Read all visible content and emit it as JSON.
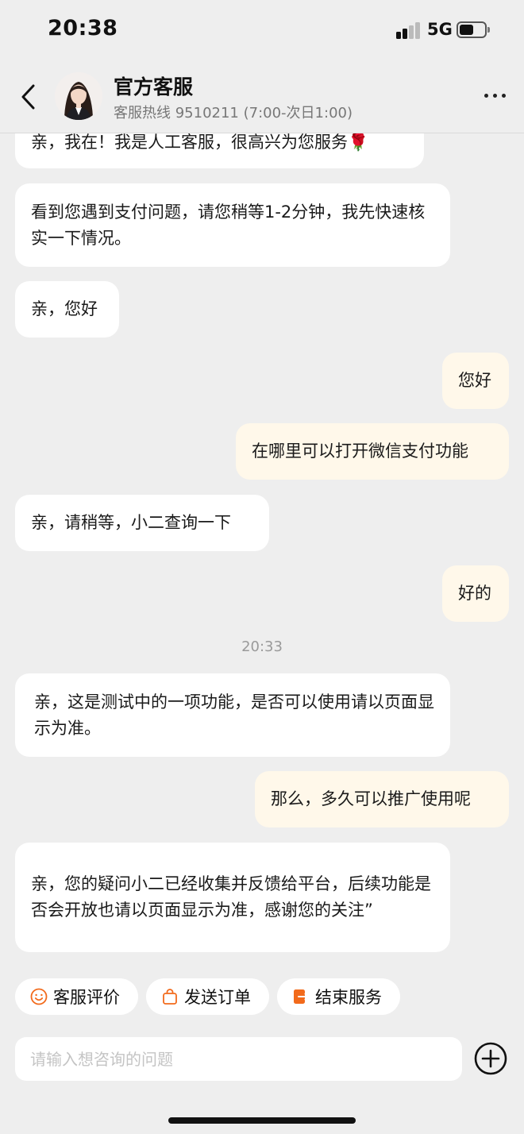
{
  "status_bar": {
    "time": "20:38",
    "network": "5G",
    "battery_level": 0.55
  },
  "header": {
    "back_icon": "chevron-left-icon",
    "title": "官方客服",
    "subtitle": "客服热线 9510211 (7:00-次日1:00)",
    "more_icon": "more-dots-icon"
  },
  "messages": [
    {
      "side": "in",
      "text": "亲，我在！我是人工客服，很高兴为您服务🌹"
    },
    {
      "side": "in",
      "text": "看到您遇到支付问题，请您稍等1-2分钟，我先快速核实一下情况。"
    },
    {
      "side": "in",
      "text": "亲，您好"
    },
    {
      "side": "out",
      "text": "您好"
    },
    {
      "side": "out",
      "text": "在哪里可以打开微信支付功能"
    },
    {
      "side": "in",
      "text": "亲，请稍等，小二查询一下"
    },
    {
      "side": "out",
      "text": "好的"
    },
    {
      "side": "in",
      "text": "亲，这是测试中的一项功能，是否可以使用请以页面显示为准。"
    },
    {
      "side": "out",
      "text": "那么，多久可以推广使用呢"
    },
    {
      "side": "in",
      "text": "亲，您的疑问小二已经收集并反馈给平台，后续功能是否会开放也请以页面显示为准，感谢您的关注”"
    }
  ],
  "timestamp": "20:33",
  "quick_actions": [
    {
      "label": "客服评价",
      "icon": "smile-icon"
    },
    {
      "label": "发送订单",
      "icon": "shopping-bag-icon"
    },
    {
      "label": "结束服务",
      "icon": "exit-icon"
    }
  ],
  "input": {
    "placeholder": "请输入想咨询的问题",
    "value": ""
  },
  "plus_icon": "plus-circle-icon",
  "colors": {
    "page_bg": "#eeeeee",
    "incoming_bubble": "#ffffff",
    "outgoing_bubble": "#fff8ea",
    "accent_orange": "#f26a1b"
  }
}
